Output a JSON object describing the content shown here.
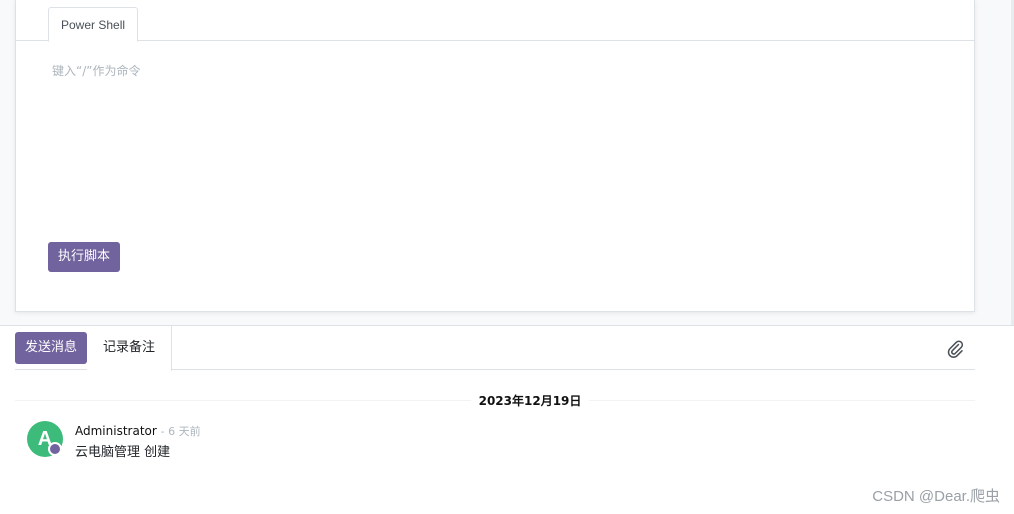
{
  "form": {
    "tabs": [
      {
        "label": "Power Shell"
      }
    ],
    "editor_placeholder": "键入“/”作为命令",
    "run_button": "执行脚本"
  },
  "chatter": {
    "send_message": "发送消息",
    "log_note": "记录备注",
    "attach_icon": "paperclip-icon",
    "date_separator": "2023年12月19日",
    "messages": [
      {
        "avatar_letter": "A",
        "author": "Administrator",
        "time": "- 6 天前",
        "body": "云电脑管理 创建"
      }
    ]
  },
  "watermark": "CSDN @Dear.爬虫",
  "colors": {
    "accent": "#71639e",
    "avatar": "#3dbb7a"
  }
}
